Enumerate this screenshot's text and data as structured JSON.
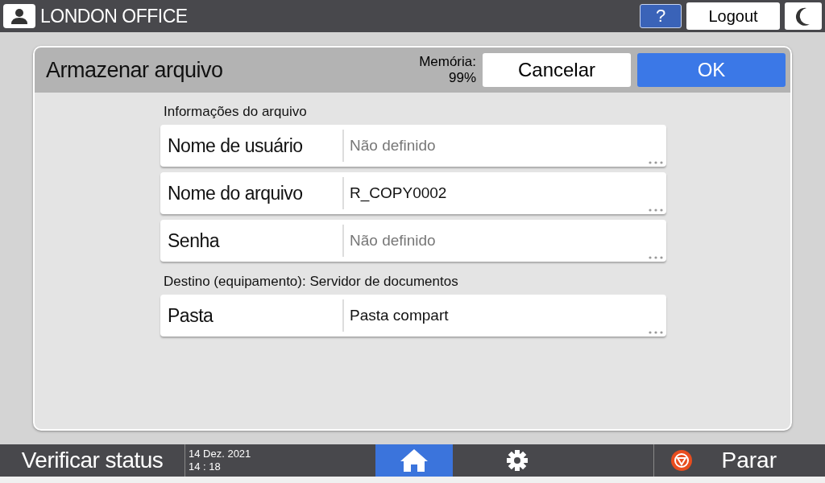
{
  "top_bar": {
    "user": "LONDON OFFICE",
    "help": "?",
    "logout": "Logout"
  },
  "dialog": {
    "title": "Armazenar arquivo",
    "memory_label": "Memória:",
    "memory_value": "99%",
    "cancel": "Cancelar",
    "ok": "OK",
    "sections": [
      {
        "heading": "Informações do arquivo",
        "fields": [
          {
            "label": "Nome de usuário",
            "placeholder": "Não definido"
          },
          {
            "label": "Nome do arquivo",
            "value": "R_COPY0002"
          },
          {
            "label": "Senha",
            "placeholder": "Não definido"
          }
        ]
      },
      {
        "heading": "Destino (equipamento): Servidor de documentos",
        "fields": [
          {
            "label": "Pasta",
            "value": "Pasta compart"
          }
        ]
      }
    ]
  },
  "bottom_bar": {
    "status": "Verificar status",
    "date": "14 Dez. 2021",
    "time": "14 : 18",
    "nav": [
      {
        "kind": "home",
        "selected": true
      },
      {
        "kind": "settings",
        "selected": false
      }
    ],
    "stop": "Parar"
  }
}
